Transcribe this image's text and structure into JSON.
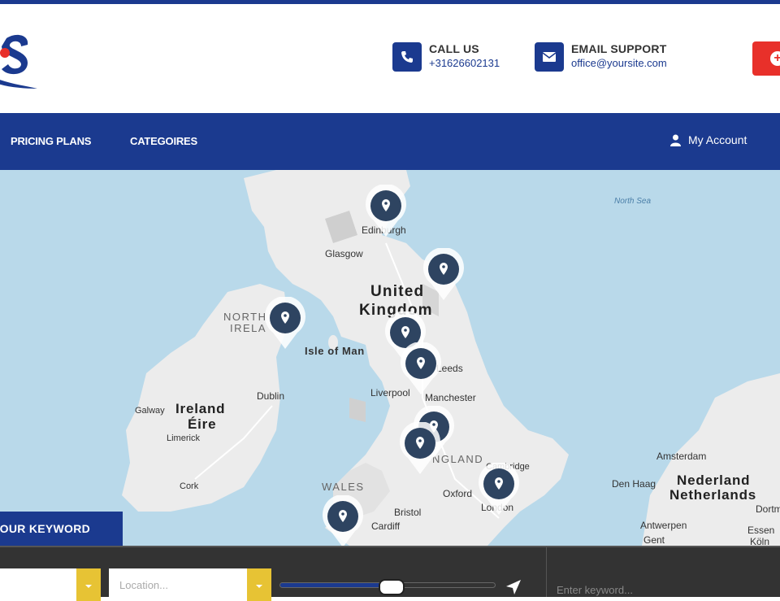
{
  "header": {
    "call_title": "CALL US",
    "call_value": "+31626602131",
    "email_title": "EMAIL SUPPORT",
    "email_value": "office@yoursite.com",
    "cta_icon": "plus-circle-icon"
  },
  "nav": {
    "items": [
      {
        "label": "PRICING PLANS"
      },
      {
        "label": "CATEGOIRES"
      }
    ],
    "account_label": "My Account"
  },
  "map": {
    "labels": {
      "north_sea": "North Sea",
      "edinburgh": "Edinburgh",
      "glasgow": "Glasgow",
      "united": "United",
      "kingdom": "Kingdom",
      "northern_ireland_1": "NORTH",
      "northern_ireland_2": "IRELA",
      "isle_of_man": "Isle of Man",
      "leeds": "Leeds",
      "liverpool": "Liverpool",
      "manchester": "Manchester",
      "galway": "Galway",
      "ireland": "Ireland",
      "eire": "Éire",
      "dublin": "Dublin",
      "limerick": "Limerick",
      "cork": "Cork",
      "england": "NGLAND",
      "wales": "WALES",
      "cambridge": "Cambridge",
      "oxford": "Oxford",
      "bristol": "Bristol",
      "cardiff": "Cardiff",
      "london": "London",
      "amsterdam": "Amsterdam",
      "den_haag": "Den Haag",
      "nederland": "Nederland",
      "netherlands": "Netherlands",
      "antwerpen": "Antwerpen",
      "gent": "Gent",
      "essen": "Essen",
      "koln": "Köln",
      "dortmund": "Dortm"
    },
    "pin_icon": "map-marker-icon"
  },
  "search": {
    "keyword_tab": "YOUR KEYWORD",
    "location_placeholder": "Location...",
    "keyword_placeholder": "Enter keyword...",
    "radius_fraction": 0.52,
    "accent": "#1b3a8f",
    "dropdown_color": "#e7c334"
  }
}
